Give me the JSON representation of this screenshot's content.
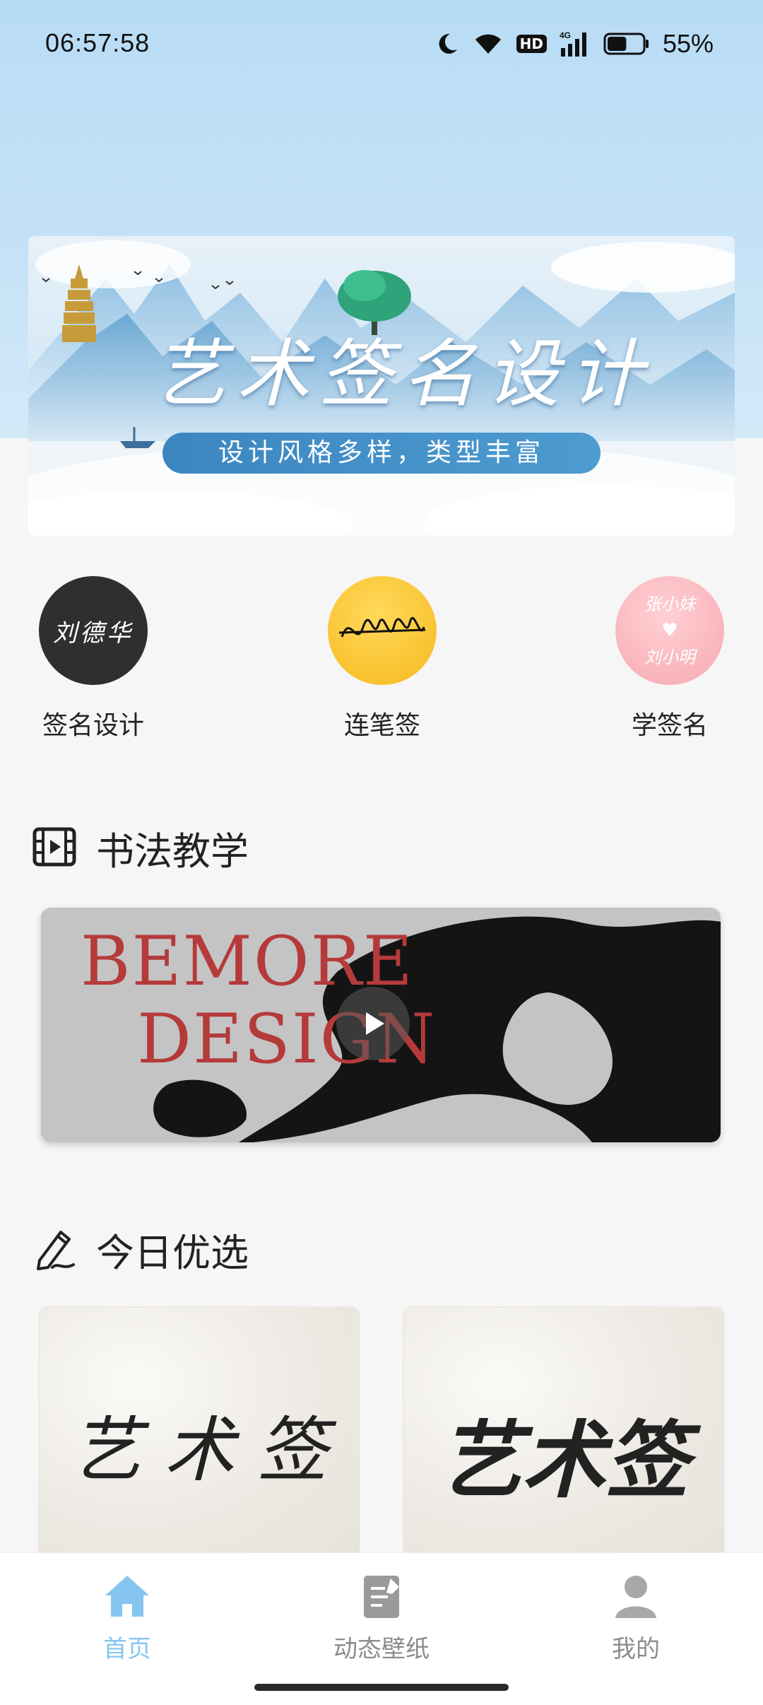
{
  "status_bar": {
    "time": "06:57:58",
    "hd_badge": "HD",
    "network": "4G",
    "battery_percent": "55%",
    "battery_level": 0.55,
    "icons": [
      "moon-icon",
      "wifi-icon",
      "hd-icon",
      "signal-icon",
      "battery-icon"
    ]
  },
  "banner": {
    "title": "艺术签名设计",
    "subtitle": "设计风格多样，类型丰富"
  },
  "quick_entries": [
    {
      "label": "签名设计",
      "art_text": "刘德华"
    },
    {
      "label": "连笔签",
      "art_text": "Ѝ∾∿ℳ"
    },
    {
      "label": "学签名",
      "art_text_top": "张小妹",
      "art_text_bottom": "刘小明"
    }
  ],
  "sections": {
    "calligraphy": {
      "title": "书法教学",
      "icon": "film-icon"
    },
    "picks": {
      "title": "今日优选",
      "icon": "pen-icon"
    }
  },
  "video": {
    "line1": "BEMORE",
    "line2": "DESIGN"
  },
  "picks": [
    {
      "text": "艺 术 签"
    },
    {
      "text": "艺术签"
    }
  ],
  "bottom_nav": {
    "items": [
      {
        "label": "首页",
        "icon": "home-icon",
        "active": true
      },
      {
        "label": "动态壁纸",
        "icon": "wallpaper-icon",
        "active": false
      },
      {
        "label": "我的",
        "icon": "user-icon",
        "active": false
      }
    ]
  },
  "colors": {
    "accent": "#86c5f0",
    "inactive": "#8c8c8c",
    "pill": "#3c86c0"
  }
}
